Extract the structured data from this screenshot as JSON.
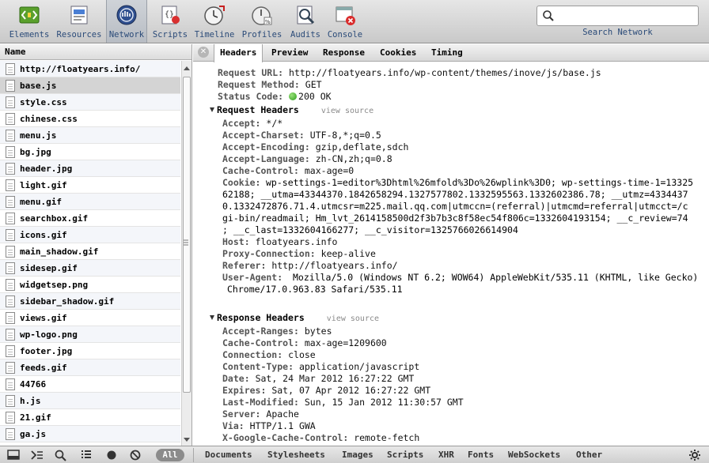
{
  "toolbar": {
    "buttons": [
      {
        "label": "Elements",
        "icon": "elements-icon"
      },
      {
        "label": "Resources",
        "icon": "resources-icon"
      },
      {
        "label": "Network",
        "icon": "network-icon"
      },
      {
        "label": "Scripts",
        "icon": "scripts-icon"
      },
      {
        "label": "Timeline",
        "icon": "timeline-icon"
      },
      {
        "label": "Profiles",
        "icon": "profiles-icon"
      },
      {
        "label": "Audits",
        "icon": "audits-icon"
      },
      {
        "label": "Console",
        "icon": "console-icon"
      }
    ],
    "selected": "Network",
    "search_placeholder": "",
    "search_label": "Search Network"
  },
  "resources": {
    "header": "Name",
    "items": [
      "http://floatyears.info/",
      "base.js",
      "style.css",
      "chinese.css",
      "menu.js",
      "bg.jpg",
      "header.jpg",
      "light.gif",
      "menu.gif",
      "searchbox.gif",
      "icons.gif",
      "main_shadow.gif",
      "sidesep.gif",
      "widgetsep.png",
      "sidebar_shadow.gif",
      "views.gif",
      "wp-logo.png",
      "footer.jpg",
      "feeds.gif",
      "44766",
      "h.js",
      "21.gif",
      "ga.js"
    ],
    "selected_index": 1
  },
  "detail_tabs": [
    "Headers",
    "Preview",
    "Response",
    "Cookies",
    "Timing"
  ],
  "selected_tab": "Headers",
  "general": {
    "url_key": "Request URL:",
    "url": "http://floatyears.info/wp-content/themes/inove/js/base.js",
    "method_key": "Request Method:",
    "method": "GET",
    "status_key": "Status Code:",
    "status": "200 OK",
    "status_color": "#2b9b1b"
  },
  "request_headers": {
    "title": "Request Headers",
    "view_source": "view source",
    "items": [
      {
        "k": "Accept:",
        "v": "*/*"
      },
      {
        "k": "Accept-Charset:",
        "v": "UTF-8,*;q=0.5"
      },
      {
        "k": "Accept-Encoding:",
        "v": "gzip,deflate,sdch"
      },
      {
        "k": "Accept-Language:",
        "v": "zh-CN,zh;q=0.8"
      },
      {
        "k": "Cache-Control:",
        "v": "max-age=0"
      }
    ],
    "cookie_key": "Cookie:",
    "cookie_lines": [
      "wp-settings-1=editor%3Dhtml%26mfold%3Do%26wplink%3D0; wp-settings-time-1=13325",
      "62188; __utma=43344370.1842658294.1327577802.1332595563.1332602386.78; __utmz=4334437",
      "0.1332472876.71.4.utmcsr=m225.mail.qq.com|utmccn=(referral)|utmcmd=referral|utmcct=/c",
      "gi-bin/readmail; Hm_lvt_2614158500d2f3b7b3c8f58ec54f806c=1332604193154; __c_review=74",
      "; __c_last=1332604166277; __c_visitor=1325766026614904"
    ],
    "items2": [
      {
        "k": "Host:",
        "v": "floatyears.info"
      },
      {
        "k": "Proxy-Connection:",
        "v": "keep-alive"
      },
      {
        "k": "Referer:",
        "v": "http://floatyears.info/"
      }
    ],
    "ua_key": "User-Agent:",
    "ua_lines": [
      "Mozilla/5.0 (Windows NT 6.2; WOW64) AppleWebKit/535.11 (KHTML, like Gecko)",
      "Chrome/17.0.963.83 Safari/535.11"
    ]
  },
  "response_headers": {
    "title": "Response Headers",
    "view_source": "view source",
    "items": [
      {
        "k": "Accept-Ranges:",
        "v": "bytes"
      },
      {
        "k": "Cache-Control:",
        "v": "max-age=1209600"
      },
      {
        "k": "Connection:",
        "v": "close"
      },
      {
        "k": "Content-Type:",
        "v": "application/javascript"
      },
      {
        "k": "Date:",
        "v": "Sat, 24 Mar 2012 16:27:22 GMT"
      },
      {
        "k": "Expires:",
        "v": "Sat, 07 Apr 2012 16:27:22 GMT"
      },
      {
        "k": "Last-Modified:",
        "v": "Sun, 15 Jan 2012 11:30:57 GMT"
      },
      {
        "k": "Server:",
        "v": "Apache"
      },
      {
        "k": "Via:",
        "v": "HTTP/1.1 GWA"
      },
      {
        "k": "X-Google-Cache-Control:",
        "v": "remote-fetch"
      }
    ]
  },
  "statusbar": {
    "all_label": "All",
    "filters": [
      "Documents",
      "Stylesheets",
      "Images",
      "Scripts",
      "XHR",
      "Fonts",
      "WebSockets",
      "Other"
    ]
  }
}
